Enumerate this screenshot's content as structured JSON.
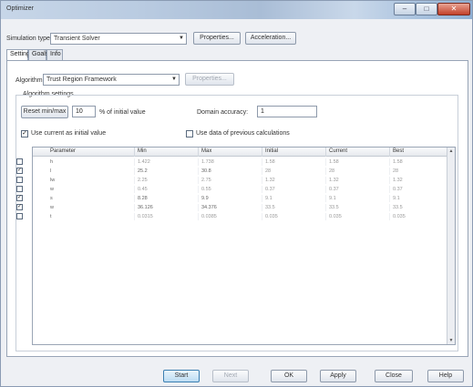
{
  "window": {
    "title": "Optimizer"
  },
  "titlebar_buttons": {
    "minimize": "–",
    "maximize": "□",
    "close": "✕"
  },
  "simulation": {
    "type_label": "Simulation type:",
    "type_value": "Transient Solver",
    "properties_label": "Properties...",
    "acceleration_label": "Acceleration..."
  },
  "tabs": [
    "Settings",
    "Goals",
    "Info"
  ],
  "algorithm": {
    "label": "Algorithm:",
    "value": "Trust Region Framework",
    "properties_label": "Properties..."
  },
  "algorithm_settings": {
    "title": "Algorithm settings",
    "reset_label": "Reset min/max",
    "reset_value": "10",
    "reset_suffix": "% of initial value",
    "domain_accuracy_label": "Domain accuracy:",
    "domain_accuracy_value": "1",
    "use_current_label": "Use current as initial value",
    "use_current_checked": "✓",
    "use_data_label": "Use data of previous calculations",
    "use_data_checked": ""
  },
  "grid": {
    "columns": [
      "Parameter",
      "Min",
      "Max",
      "Initial",
      "Current",
      "Best"
    ],
    "rows": [
      {
        "checked": "",
        "cells": [
          "h",
          "1.422",
          "1.738",
          "1.58",
          "1.58",
          "1.58"
        ]
      },
      {
        "checked": "✓",
        "cells": [
          "l",
          "25.2",
          "30.8",
          "28",
          "28",
          "28"
        ]
      },
      {
        "checked": "",
        "cells": [
          "lw",
          "2.25",
          "2.75",
          "1.32",
          "1.32",
          "1.32"
        ]
      },
      {
        "checked": "",
        "cells": [
          "w",
          "0.45",
          "0.55",
          "0.37",
          "0.37",
          "0.37"
        ]
      },
      {
        "checked": "✓",
        "cells": [
          "s",
          "8.28",
          "9.9",
          "9.1",
          "9.1",
          "9.1"
        ]
      },
      {
        "checked": "✓",
        "cells": [
          "w",
          "36.126",
          "34.376",
          "33.5",
          "33.5",
          "33.5"
        ]
      },
      {
        "checked": "",
        "cells": [
          "t",
          "0.0315",
          "0.0385",
          "0.035",
          "0.035",
          "0.035"
        ]
      }
    ]
  },
  "footer": {
    "start": "Start",
    "next": "Next",
    "ok": "OK",
    "apply": "Apply",
    "close": "Close",
    "help": "Help"
  }
}
